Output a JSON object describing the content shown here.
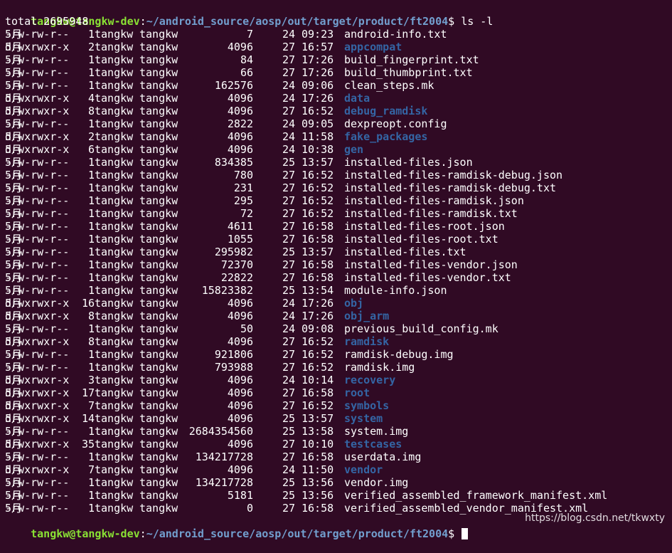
{
  "prompt_top": {
    "userhost": "tangkw@tangkw-dev",
    "sep": ":",
    "path": "~/android_source/aosp/out/target/product/ft2004",
    "symbol": "$",
    "command": " ls -l"
  },
  "total": "total 2695948",
  "entries": [
    {
      "perm": "-rw-rw-r--",
      "links": "1",
      "owner": "tangkw",
      "group": "tangkw",
      "size": "7",
      "month": "5月",
      "day": "24",
      "time": "09:23",
      "name": "android-info.txt",
      "dir": false
    },
    {
      "perm": "drwxrwxr-x",
      "links": "2",
      "owner": "tangkw",
      "group": "tangkw",
      "size": "4096",
      "month": "5月",
      "day": "27",
      "time": "16:57",
      "name": "appcompat",
      "dir": true
    },
    {
      "perm": "-rw-rw-r--",
      "links": "1",
      "owner": "tangkw",
      "group": "tangkw",
      "size": "84",
      "month": "5月",
      "day": "27",
      "time": "17:26",
      "name": "build_fingerprint.txt",
      "dir": false
    },
    {
      "perm": "-rw-rw-r--",
      "links": "1",
      "owner": "tangkw",
      "group": "tangkw",
      "size": "66",
      "month": "5月",
      "day": "27",
      "time": "17:26",
      "name": "build_thumbprint.txt",
      "dir": false
    },
    {
      "perm": "-rw-rw-r--",
      "links": "1",
      "owner": "tangkw",
      "group": "tangkw",
      "size": "162576",
      "month": "5月",
      "day": "24",
      "time": "09:06",
      "name": "clean_steps.mk",
      "dir": false
    },
    {
      "perm": "drwxrwxr-x",
      "links": "4",
      "owner": "tangkw",
      "group": "tangkw",
      "size": "4096",
      "month": "5月",
      "day": "24",
      "time": "17:26",
      "name": "data",
      "dir": true
    },
    {
      "perm": "drwxrwxr-x",
      "links": "8",
      "owner": "tangkw",
      "group": "tangkw",
      "size": "4096",
      "month": "5月",
      "day": "27",
      "time": "16:52",
      "name": "debug_ramdisk",
      "dir": true
    },
    {
      "perm": "-rw-rw-r--",
      "links": "1",
      "owner": "tangkw",
      "group": "tangkw",
      "size": "2822",
      "month": "5月",
      "day": "24",
      "time": "09:05",
      "name": "dexpreopt.config",
      "dir": false
    },
    {
      "perm": "drwxrwxr-x",
      "links": "2",
      "owner": "tangkw",
      "group": "tangkw",
      "size": "4096",
      "month": "5月",
      "day": "24",
      "time": "11:58",
      "name": "fake_packages",
      "dir": true
    },
    {
      "perm": "drwxrwxr-x",
      "links": "6",
      "owner": "tangkw",
      "group": "tangkw",
      "size": "4096",
      "month": "5月",
      "day": "24",
      "time": "10:38",
      "name": "gen",
      "dir": true
    },
    {
      "perm": "-rw-rw-r--",
      "links": "1",
      "owner": "tangkw",
      "group": "tangkw",
      "size": "834385",
      "month": "5月",
      "day": "25",
      "time": "13:57",
      "name": "installed-files.json",
      "dir": false
    },
    {
      "perm": "-rw-rw-r--",
      "links": "1",
      "owner": "tangkw",
      "group": "tangkw",
      "size": "780",
      "month": "5月",
      "day": "27",
      "time": "16:52",
      "name": "installed-files-ramdisk-debug.json",
      "dir": false
    },
    {
      "perm": "-rw-rw-r--",
      "links": "1",
      "owner": "tangkw",
      "group": "tangkw",
      "size": "231",
      "month": "5月",
      "day": "27",
      "time": "16:52",
      "name": "installed-files-ramdisk-debug.txt",
      "dir": false
    },
    {
      "perm": "-rw-rw-r--",
      "links": "1",
      "owner": "tangkw",
      "group": "tangkw",
      "size": "295",
      "month": "5月",
      "day": "27",
      "time": "16:52",
      "name": "installed-files-ramdisk.json",
      "dir": false
    },
    {
      "perm": "-rw-rw-r--",
      "links": "1",
      "owner": "tangkw",
      "group": "tangkw",
      "size": "72",
      "month": "5月",
      "day": "27",
      "time": "16:52",
      "name": "installed-files-ramdisk.txt",
      "dir": false
    },
    {
      "perm": "-rw-rw-r--",
      "links": "1",
      "owner": "tangkw",
      "group": "tangkw",
      "size": "4611",
      "month": "5月",
      "day": "27",
      "time": "16:58",
      "name": "installed-files-root.json",
      "dir": false
    },
    {
      "perm": "-rw-rw-r--",
      "links": "1",
      "owner": "tangkw",
      "group": "tangkw",
      "size": "1055",
      "month": "5月",
      "day": "27",
      "time": "16:58",
      "name": "installed-files-root.txt",
      "dir": false
    },
    {
      "perm": "-rw-rw-r--",
      "links": "1",
      "owner": "tangkw",
      "group": "tangkw",
      "size": "295982",
      "month": "5月",
      "day": "25",
      "time": "13:57",
      "name": "installed-files.txt",
      "dir": false
    },
    {
      "perm": "-rw-rw-r--",
      "links": "1",
      "owner": "tangkw",
      "group": "tangkw",
      "size": "72370",
      "month": "5月",
      "day": "27",
      "time": "16:58",
      "name": "installed-files-vendor.json",
      "dir": false
    },
    {
      "perm": "-rw-rw-r--",
      "links": "1",
      "owner": "tangkw",
      "group": "tangkw",
      "size": "22822",
      "month": "5月",
      "day": "27",
      "time": "16:58",
      "name": "installed-files-vendor.txt",
      "dir": false
    },
    {
      "perm": "-rw-rw-r--",
      "links": "1",
      "owner": "tangkw",
      "group": "tangkw",
      "size": "15823382",
      "month": "5月",
      "day": "25",
      "time": "13:54",
      "name": "module-info.json",
      "dir": false
    },
    {
      "perm": "drwxrwxr-x",
      "links": "16",
      "owner": "tangkw",
      "group": "tangkw",
      "size": "4096",
      "month": "5月",
      "day": "24",
      "time": "17:26",
      "name": "obj",
      "dir": true
    },
    {
      "perm": "drwxrwxr-x",
      "links": "8",
      "owner": "tangkw",
      "group": "tangkw",
      "size": "4096",
      "month": "5月",
      "day": "24",
      "time": "17:26",
      "name": "obj_arm",
      "dir": true
    },
    {
      "perm": "-rw-rw-r--",
      "links": "1",
      "owner": "tangkw",
      "group": "tangkw",
      "size": "50",
      "month": "5月",
      "day": "24",
      "time": "09:08",
      "name": "previous_build_config.mk",
      "dir": false
    },
    {
      "perm": "drwxrwxr-x",
      "links": "8",
      "owner": "tangkw",
      "group": "tangkw",
      "size": "4096",
      "month": "5月",
      "day": "27",
      "time": "16:52",
      "name": "ramdisk",
      "dir": true
    },
    {
      "perm": "-rw-rw-r--",
      "links": "1",
      "owner": "tangkw",
      "group": "tangkw",
      "size": "921806",
      "month": "5月",
      "day": "27",
      "time": "16:52",
      "name": "ramdisk-debug.img",
      "dir": false
    },
    {
      "perm": "-rw-rw-r--",
      "links": "1",
      "owner": "tangkw",
      "group": "tangkw",
      "size": "793988",
      "month": "5月",
      "day": "27",
      "time": "16:52",
      "name": "ramdisk.img",
      "dir": false
    },
    {
      "perm": "drwxrwxr-x",
      "links": "3",
      "owner": "tangkw",
      "group": "tangkw",
      "size": "4096",
      "month": "5月",
      "day": "24",
      "time": "10:14",
      "name": "recovery",
      "dir": true
    },
    {
      "perm": "drwxrwxr-x",
      "links": "17",
      "owner": "tangkw",
      "group": "tangkw",
      "size": "4096",
      "month": "5月",
      "day": "27",
      "time": "16:58",
      "name": "root",
      "dir": true
    },
    {
      "perm": "drwxrwxr-x",
      "links": "7",
      "owner": "tangkw",
      "group": "tangkw",
      "size": "4096",
      "month": "5月",
      "day": "27",
      "time": "16:52",
      "name": "symbols",
      "dir": true
    },
    {
      "perm": "drwxrwxr-x",
      "links": "14",
      "owner": "tangkw",
      "group": "tangkw",
      "size": "4096",
      "month": "5月",
      "day": "25",
      "time": "13:57",
      "name": "system",
      "dir": true
    },
    {
      "perm": "-rw-rw-r--",
      "links": "1",
      "owner": "tangkw",
      "group": "tangkw",
      "size": "2684354560",
      "month": "5月",
      "day": "25",
      "time": "13:58",
      "name": "system.img",
      "dir": false
    },
    {
      "perm": "drwxrwxr-x",
      "links": "35",
      "owner": "tangkw",
      "group": "tangkw",
      "size": "4096",
      "month": "5月",
      "day": "27",
      "time": "10:10",
      "name": "testcases",
      "dir": true
    },
    {
      "perm": "-rw-rw-r--",
      "links": "1",
      "owner": "tangkw",
      "group": "tangkw",
      "size": "134217728",
      "month": "5月",
      "day": "27",
      "time": "16:58",
      "name": "userdata.img",
      "dir": false
    },
    {
      "perm": "drwxrwxr-x",
      "links": "7",
      "owner": "tangkw",
      "group": "tangkw",
      "size": "4096",
      "month": "5月",
      "day": "24",
      "time": "11:50",
      "name": "vendor",
      "dir": true
    },
    {
      "perm": "-rw-rw-r--",
      "links": "1",
      "owner": "tangkw",
      "group": "tangkw",
      "size": "134217728",
      "month": "5月",
      "day": "25",
      "time": "13:56",
      "name": "vendor.img",
      "dir": false
    },
    {
      "perm": "-rw-rw-r--",
      "links": "1",
      "owner": "tangkw",
      "group": "tangkw",
      "size": "5181",
      "month": "5月",
      "day": "25",
      "time": "13:56",
      "name": "verified_assembled_framework_manifest.xml",
      "dir": false
    },
    {
      "perm": "-rw-rw-r--",
      "links": "1",
      "owner": "tangkw",
      "group": "tangkw",
      "size": "0",
      "month": "5月",
      "day": "27",
      "time": "16:58",
      "name": "verified_assembled_vendor_manifest.xml",
      "dir": false
    }
  ],
  "prompt_bottom": {
    "userhost": "tangkw@tangkw-dev",
    "sep": ":",
    "path": "~/android_source/aosp/out/target/product/ft2004",
    "symbol": "$",
    "command": " "
  },
  "watermark": "https://blog.csdn.net/tkwxty",
  "colors": {
    "background": "#300a24",
    "prompt_user": "#8ae234",
    "prompt_path": "#729fcf",
    "directory": "#3465a4",
    "text": "#ffffff"
  }
}
